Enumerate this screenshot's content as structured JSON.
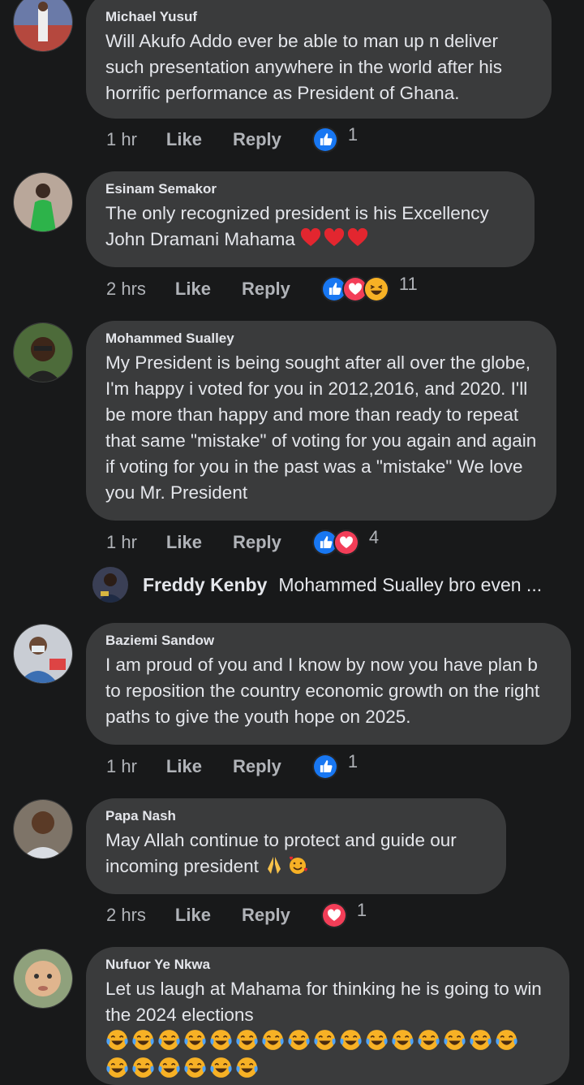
{
  "comments": [
    {
      "name": "Michael Yusuf",
      "text": "Will Akufo Addo ever be able to man up n deliver such presentation anywhere in the world after his horrific performance as President of Ghana.",
      "time": "1 hr",
      "like": "Like",
      "reply": "Reply",
      "reactions": [
        "like"
      ],
      "count": "1"
    },
    {
      "name": "Esinam Semakor",
      "text": "The only recognized president is his Excellency John Dramani Mahama",
      "text_emojis": [
        "red-heart",
        "red-heart",
        "red-heart"
      ],
      "time": "2 hrs",
      "like": "Like",
      "reply": "Reply",
      "reactions": [
        "like",
        "love",
        "haha"
      ],
      "count": "11"
    },
    {
      "name": "Mohammed Sualley",
      "text": "My President is being sought after all over the globe, I'm happy i voted for you in 2012,2016, and 2020. I'll be more than happy and more than ready to repeat that same \"mistake\" of voting for you again and again if voting for you in the past was a \"mistake\" We love you Mr. President",
      "time": "1 hr",
      "like": "Like",
      "reply": "Reply",
      "reactions": [
        "like",
        "love"
      ],
      "count": "4"
    },
    {
      "name": "Baziemi Sandow",
      "text": "I am proud of you and I know by now  you have plan b to reposition the country economic growth on the right paths to give the youth hope on 2025.",
      "time": "1 hr",
      "like": "Like",
      "reply": "Reply",
      "reactions": [
        "like"
      ],
      "count": "1"
    },
    {
      "name": "Papa Nash",
      "text": "May Allah continue to protect and guide our incoming president",
      "text_emojis": [
        "folded-hands",
        "smiling-face-with-hearts"
      ],
      "time": "2 hrs",
      "like": "Like",
      "reply": "Reply",
      "reactions": [
        "love"
      ],
      "count": "1"
    },
    {
      "name": "Nufuor Ye Nkwa",
      "text": "Let us laugh at Mahama for thinking he is going to win the 2024 elections",
      "text_emojis": [
        "tears-of-joy"
      ],
      "time": "",
      "like": "",
      "reply": "",
      "reactions": [],
      "count": ""
    }
  ],
  "reply_preview": {
    "name": "Freddy Kenby",
    "text": "Mohammed Sualley bro even ..."
  },
  "colors": {
    "background": "#18191a",
    "bubble": "#3a3b3c",
    "text": "#e4e6eb",
    "muted": "#b0b3b8",
    "like_blue": "#1877f2",
    "love_red": "#f33e58",
    "haha_yellow": "#f7b125"
  }
}
